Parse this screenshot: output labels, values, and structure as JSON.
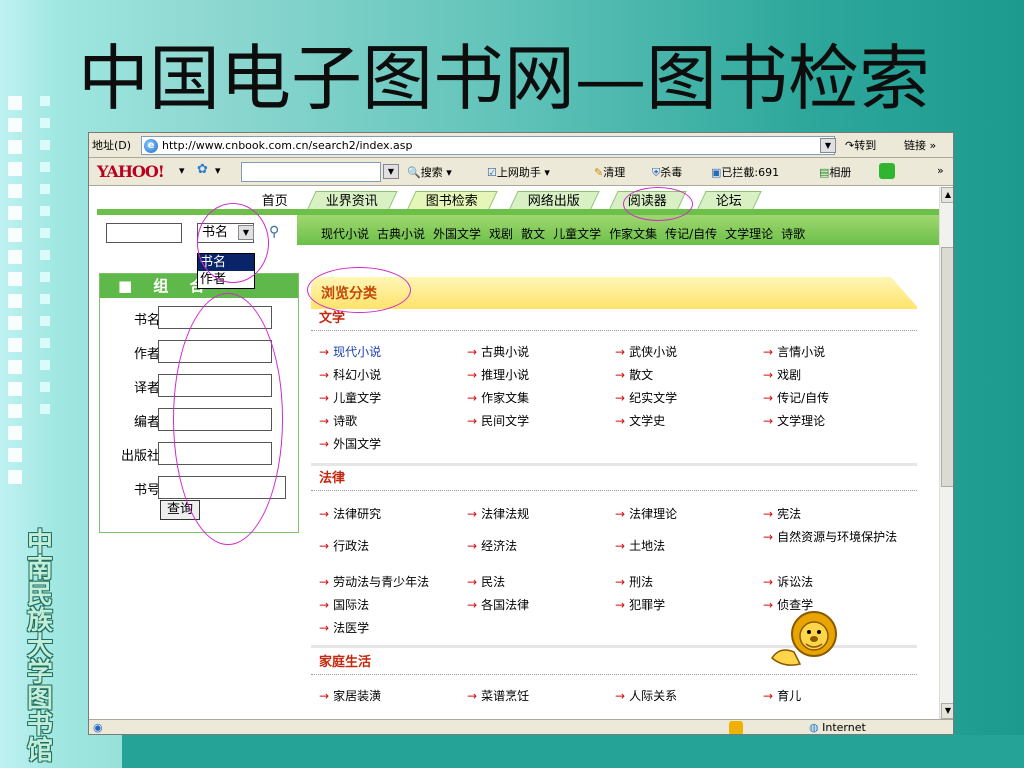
{
  "slide": {
    "title": "中国电子图书网—图书检索",
    "side_label": "中南民族大学图书馆"
  },
  "browser": {
    "address_label": "地址(D)",
    "url": "http://www.cnbook.com.cn/search2/index.asp",
    "go_label": "转到",
    "links_label": "链接 »",
    "toolbar": {
      "brand": "YAHOO!",
      "search_label": "搜索",
      "assistant_label": "上网助手",
      "clean_label": "清理",
      "antivirus_label": "杀毒",
      "blocked_label": "已拦截:691",
      "album_label": "相册",
      "more_label": "»"
    },
    "status": {
      "zone": "Internet"
    }
  },
  "site": {
    "nav": [
      "首页",
      "业界资讯",
      "图书检索",
      "网络出版",
      "阅读器",
      "论坛"
    ],
    "search": {
      "select_value": "书名",
      "options": [
        "书名",
        "作者"
      ],
      "categories": [
        "现代小说",
        "古典小说",
        "外国文学",
        "戏剧",
        "散文",
        "儿童文学",
        "作家文集",
        "传记/自传",
        "文学理论",
        "诗歌"
      ]
    },
    "combo": {
      "title": "■ 组 合",
      "fields": [
        "书名",
        "作者",
        "译者",
        "编者",
        "出版社",
        "书号"
      ],
      "submit_label": "查询"
    },
    "browse": {
      "title": "浏览分类",
      "sections": [
        {
          "title": "文学",
          "links": [
            "现代小说",
            "古典小说",
            "武侠小说",
            "言情小说",
            "科幻小说",
            "推理小说",
            "散文",
            "戏剧",
            "儿童文学",
            "作家文集",
            "纪实文学",
            "传记/自传",
            "诗歌",
            "民间文学",
            "文学史",
            "文学理论",
            "外国文学"
          ]
        },
        {
          "title": "法律",
          "links": [
            "法律研究",
            "法律法规",
            "法律理论",
            "宪法",
            "行政法",
            "经济法",
            "土地法",
            "自然资源与环境保护法",
            "劳动法与青少年法",
            "民法",
            "刑法",
            "诉讼法",
            "国际法",
            "各国法律",
            "犯罪学",
            "侦查学",
            "法医学"
          ]
        },
        {
          "title": "家庭生活",
          "links": [
            "家居装潢",
            "菜谱烹饪",
            "人际关系",
            "育儿"
          ]
        }
      ]
    }
  },
  "colors": {
    "bg_gradient_start": "#bff2f2",
    "bg_gradient_end": "#1c9a8e",
    "site_green": "#6cc04a",
    "accent_red": "#d01010",
    "annotation_magenta": "#d02acf"
  }
}
